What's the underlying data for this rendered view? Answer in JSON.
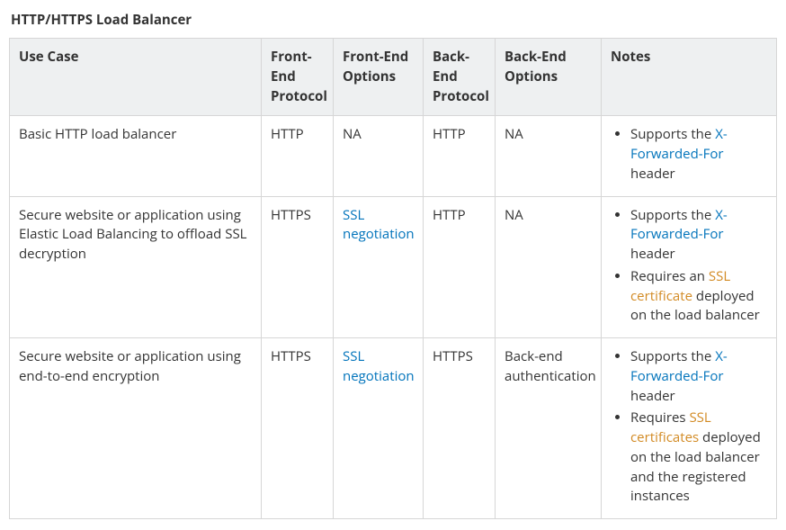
{
  "title": "HTTP/HTTPS Load Balancer",
  "headers": {
    "use_case": "Use Case",
    "fe_protocol": "Front-End Protocol",
    "fe_options": "Front-End Options",
    "be_protocol": "Back-End Protocol",
    "be_options": "Back-End Options",
    "notes": "Notes"
  },
  "rows": [
    {
      "use_case": "Basic HTTP load balancer",
      "fe_protocol": "HTTP",
      "fe_options": {
        "text": "NA",
        "is_link": false
      },
      "be_protocol": "HTTP",
      "be_options": "NA",
      "notes": [
        {
          "parts": [
            {
              "t": "Supports the "
            },
            {
              "t": "X-Forwarded-For",
              "link": "blue"
            },
            {
              "t": " header"
            }
          ]
        }
      ]
    },
    {
      "use_case": "Secure website or application using Elastic Load Balancing to offload SSL decryption",
      "fe_protocol": "HTTPS",
      "fe_options": {
        "text": "SSL negotiation",
        "is_link": true
      },
      "be_protocol": "HTTP",
      "be_options": "NA",
      "notes": [
        {
          "parts": [
            {
              "t": "Supports the "
            },
            {
              "t": "X-Forwarded-For",
              "link": "blue"
            },
            {
              "t": " header"
            }
          ]
        },
        {
          "parts": [
            {
              "t": "Requires an "
            },
            {
              "t": "SSL certificate",
              "link": "orange"
            },
            {
              "t": " deployed on the load balancer"
            }
          ]
        }
      ]
    },
    {
      "use_case": "Secure website or application using end-to-end encryption",
      "fe_protocol": "HTTPS",
      "fe_options": {
        "text": "SSL negotiation",
        "is_link": true
      },
      "be_protocol": "HTTPS",
      "be_options": "Back-end authentication",
      "notes": [
        {
          "parts": [
            {
              "t": "Supports the "
            },
            {
              "t": "X-Forwarded-For",
              "link": "blue"
            },
            {
              "t": " header"
            }
          ]
        },
        {
          "parts": [
            {
              "t": "Requires "
            },
            {
              "t": "SSL certificates",
              "link": "orange"
            },
            {
              "t": " deployed on the load balancer and the registered instances"
            }
          ]
        }
      ]
    }
  ]
}
